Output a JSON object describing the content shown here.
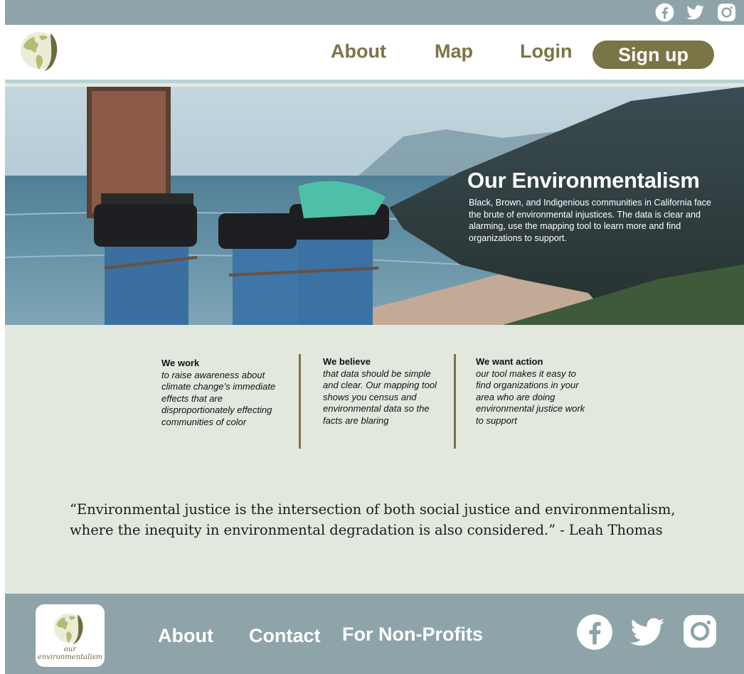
{
  "topbar": {
    "social": [
      {
        "icon": "facebook-icon"
      },
      {
        "icon": "twitter-icon"
      },
      {
        "icon": "instagram-icon"
      }
    ]
  },
  "header": {
    "nav": {
      "about": "About",
      "map": "Map",
      "login": "Login"
    },
    "signup_label": "Sign up"
  },
  "hero": {
    "title": "Our Environmentalism",
    "text": "Black, Brown, and Indigenious communities in California face the brute of environmental injustices. The data is clear and alarming, use the mapping tool to learn more and find organizations to support."
  },
  "columns": [
    {
      "heading": "We work",
      "body": "to raise awareness about climate change’s immediate effects that are disproportionately effecting communities of color"
    },
    {
      "heading": "We believe",
      "body": "that data should be simple and clear. Our mapping tool shows you census and environmental data so the facts are blaring"
    },
    {
      "heading": "We want action",
      "body": "our tool makes it easy to find organizations in your area who are doing environmental justice work to support"
    }
  ],
  "quote": {
    "line1": "“Environmental justice is the intersection of both social justice and environmentalism,",
    "line2": "where the inequity in environmental degradation is also considered.” - Leah Thomas"
  },
  "footer": {
    "logo_text_line1": "our",
    "logo_text_line2": "environmentalism",
    "links": {
      "about": "About",
      "contact": "Contact",
      "nonprofits": "For Non-Profits"
    }
  },
  "colors": {
    "accent": "#7a7546",
    "bar": "#8ea4a8",
    "background": "#e3e8df"
  }
}
